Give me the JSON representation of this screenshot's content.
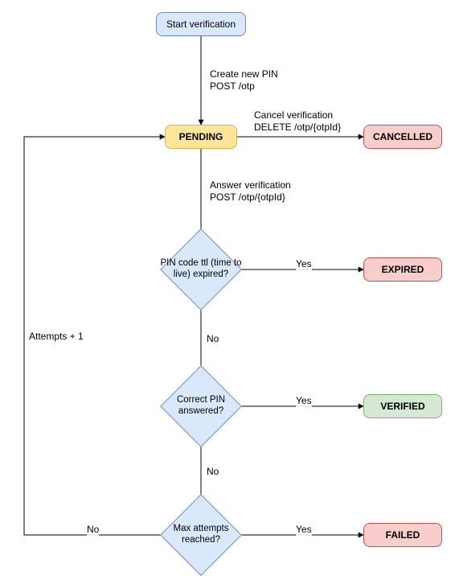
{
  "chart_data": {
    "type": "flowchart",
    "nodes": {
      "start": {
        "label": "Start verification",
        "kind": "start"
      },
      "pending": {
        "label": "PENDING",
        "kind": "state"
      },
      "cancelled": {
        "label": "CANCELLED",
        "kind": "terminal"
      },
      "ttl": {
        "label": "PIN code ttl (time to\nlive) expired?",
        "kind": "decision"
      },
      "expired": {
        "label": "EXPIRED",
        "kind": "terminal"
      },
      "correct": {
        "label": "Correct PIN\nanswered?",
        "kind": "decision"
      },
      "verified": {
        "label": "VERIFIED",
        "kind": "terminal"
      },
      "max": {
        "label": "Max attempts\nreached?",
        "kind": "decision"
      },
      "failed": {
        "label": "FAILED",
        "kind": "terminal"
      }
    },
    "edges": [
      {
        "from": "start",
        "to": "pending",
        "label": "Create new PIN\nPOST /otp"
      },
      {
        "from": "pending",
        "to": "cancelled",
        "label": "Cancel verification\nDELETE /otp/{otpId}"
      },
      {
        "from": "pending",
        "to": "ttl",
        "label": "Answer verification\nPOST /otp/{otpId}"
      },
      {
        "from": "ttl",
        "to": "expired",
        "label": "Yes"
      },
      {
        "from": "ttl",
        "to": "correct",
        "label": "No"
      },
      {
        "from": "correct",
        "to": "verified",
        "label": "Yes"
      },
      {
        "from": "correct",
        "to": "max",
        "label": "No"
      },
      {
        "from": "max",
        "to": "failed",
        "label": "Yes"
      },
      {
        "from": "max",
        "to": "pending",
        "label": "No",
        "side_label": "Attempts + 1"
      }
    ]
  },
  "nodes": {
    "start": "Start verification",
    "pending": "PENDING",
    "cancelled": "CANCELLED",
    "ttl": "PIN code ttl (time to live) expired?",
    "expired": "EXPIRED",
    "correct": "Correct PIN answered?",
    "verified": "VERIFIED",
    "max": "Max attempts reached?",
    "failed": "FAILED"
  },
  "edges": {
    "create": "Create new PIN\nPOST /otp",
    "cancel": "Cancel verification\nDELETE /otp/{otpId}",
    "answer": "Answer verification\nPOST /otp/{otpId}",
    "ttl_yes": "Yes",
    "ttl_no": "No",
    "correct_yes": "Yes",
    "correct_no": "No",
    "max_yes": "Yes",
    "max_no": "No",
    "attempts": "Attempts + 1"
  }
}
